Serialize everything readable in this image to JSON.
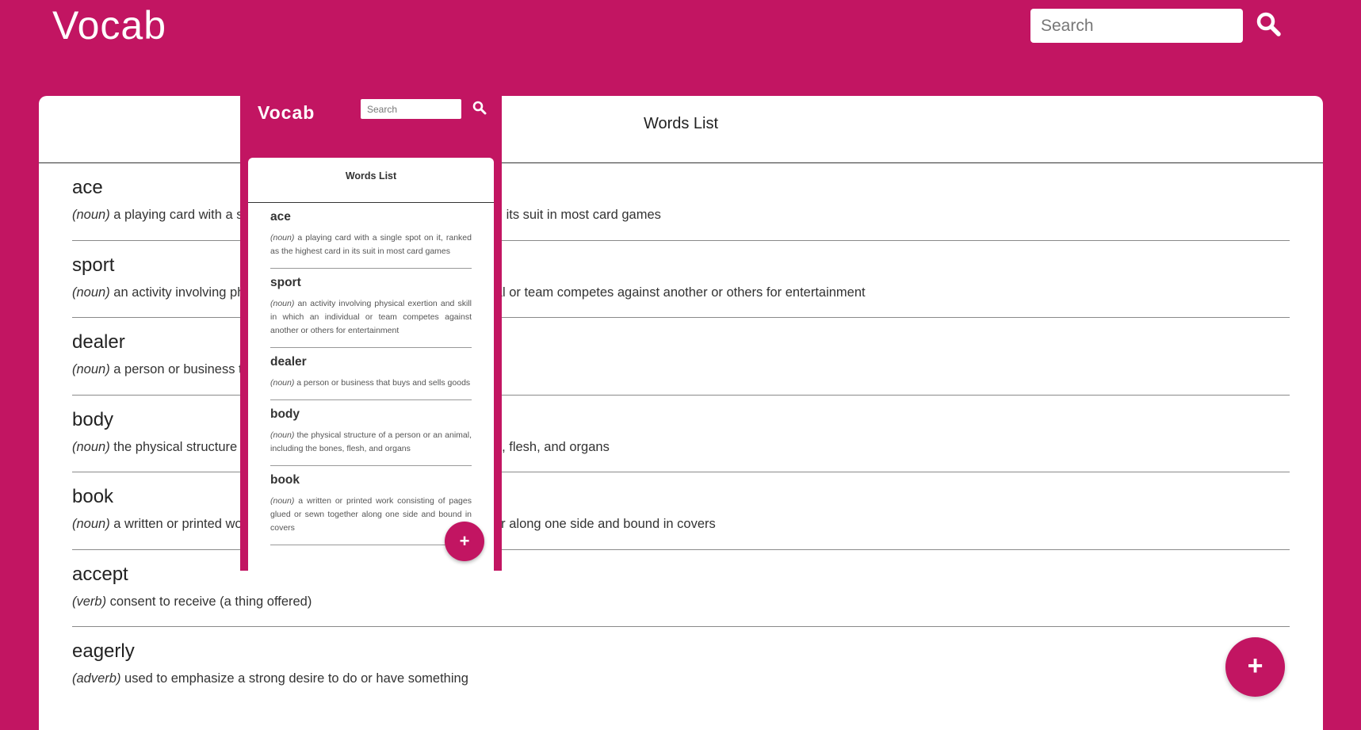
{
  "header": {
    "title": "Vocab",
    "search_placeholder": "Search",
    "search_icon": "magnifier-icon"
  },
  "main": {
    "card_title": "Words List",
    "words": [
      {
        "word": "ace",
        "pos": "(noun)",
        "definition": " a playing card with a single spot on it, ranked as the highest card in its suit in most card games"
      },
      {
        "word": "sport",
        "pos": "(noun)",
        "definition": " an activity involving physical exertion and skill in which an individual or team competes against another or others for entertainment"
      },
      {
        "word": "dealer",
        "pos": "(noun)",
        "definition": " a person or business that buys and sells goods"
      },
      {
        "word": "body",
        "pos": "(noun)",
        "definition": " the physical structure of a person or an animal, including the bones, flesh, and organs"
      },
      {
        "word": "book",
        "pos": "(noun)",
        "definition": " a written or printed work consisting of pages glued or sewn together along one side and bound in covers"
      },
      {
        "word": "accept",
        "pos": "(verb)",
        "definition": " consent to receive (a thing offered)"
      },
      {
        "word": "eagerly",
        "pos": "(adverb)",
        "definition": " used to emphasize a strong desire to do or have something"
      }
    ],
    "add_label": "+"
  },
  "mobile_preview": {
    "title": "Vocab",
    "search_placeholder": "Search",
    "card_title": "Words List",
    "add_label": "+"
  },
  "colors": {
    "brand": "#c21562",
    "card": "#ffffff"
  }
}
